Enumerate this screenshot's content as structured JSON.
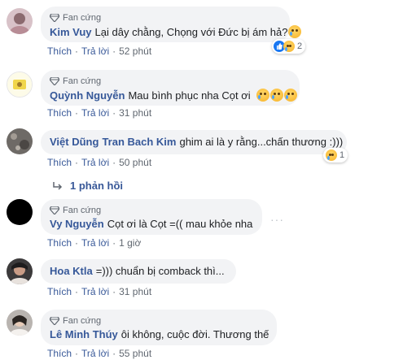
{
  "badge_label": "Fan cứng",
  "actions": {
    "like": "Thích",
    "reply": "Trả lời",
    "sep": "·"
  },
  "comments": [
    {
      "author": "Kim Vuy",
      "text": "Lại dây chằng, Chọng với Đức bị ám hả?",
      "time": "52 phút",
      "reaction_count": "2"
    },
    {
      "author": "Quỳnh Nguyễn",
      "text": "Mau bình phục nha Cọt ơi",
      "time": "31 phút"
    },
    {
      "author": "Việt Dũng",
      "mention": "Tran Bach Kim",
      "text": "ghim ai là y rằng...chấn thương :)))",
      "time": "50 phút",
      "reaction_count": "1",
      "replies": "1 phản hồi"
    },
    {
      "author": "Vy Nguyễn",
      "text": "Cọt ơi là Cọt =(( mau khỏe nha",
      "time": "1 giờ"
    },
    {
      "author": "Hoa Ktla",
      "text": "=))) chuẩn bị comback thì...",
      "time": "31 phút"
    },
    {
      "author": "Lê Minh Thúy",
      "text": "ôi không, cuộc đời. Thương thế",
      "time": "55 phút"
    }
  ],
  "icons": {
    "badge": "diamond-icon",
    "reply": "reply-arrow-icon",
    "more": "more-options-icon"
  },
  "colors": {
    "link": "#385898",
    "bubble": "#f2f3f5",
    "meta": "#606770"
  }
}
